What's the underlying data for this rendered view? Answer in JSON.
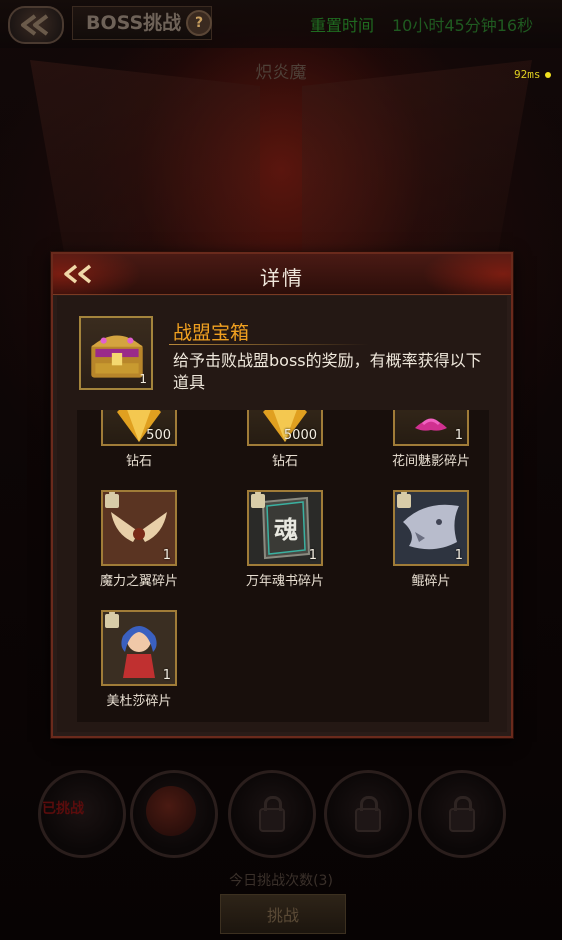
{
  "header": {
    "title": "BOSS挑战",
    "help_icon": "?",
    "reset_label": "重置时间",
    "reset_value": "10小时45分钟16秒"
  },
  "boss_name": "炽炎魔",
  "ping": "92ms",
  "bottom": {
    "slot_label": "已挑战",
    "today_count": "今日挑战次数(3)",
    "challenge_button": "挑战"
  },
  "dialog": {
    "title": "详情",
    "item": {
      "name": "战盟宝箱",
      "count": "1",
      "description": "给予击败战盟boss的奖励，有概率获得以下道具"
    },
    "rewards": [
      {
        "label": "钻石",
        "count": "500",
        "icon": "diamond-icon"
      },
      {
        "label": "钻石",
        "count": "5000",
        "icon": "diamond-icon"
      },
      {
        "label": "花间魅影碎片",
        "count": "1",
        "icon": "flower-shadow-fragment-icon"
      },
      {
        "label": "魔力之翼碎片",
        "count": "1",
        "icon": "magic-wing-fragment-icon"
      },
      {
        "label": "万年魂书碎片",
        "count": "1",
        "icon": "soul-book-fragment-icon"
      },
      {
        "label": "鲲碎片",
        "count": "1",
        "icon": "kun-fragment-icon"
      },
      {
        "label": "美杜莎碎片",
        "count": "1",
        "icon": "medusa-fragment-icon"
      }
    ],
    "soul_book_glyph": "魂"
  },
  "colors": {
    "accent_orange": "#f0a020",
    "frame_gold": "#a07c38",
    "reset_green": "#1f6a20"
  }
}
